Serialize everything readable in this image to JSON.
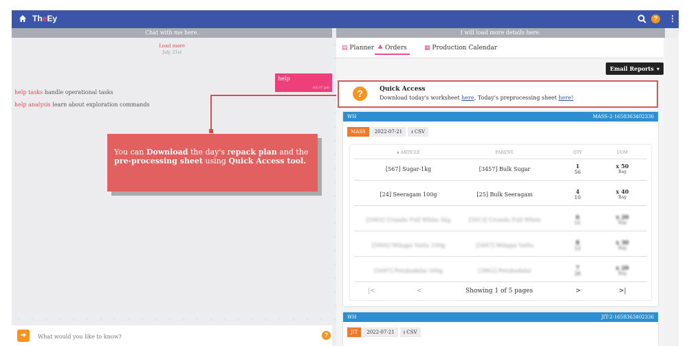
{
  "app": {
    "title_prefix": "Th",
    "title_mid": "e",
    "title_suffix": "Ey"
  },
  "header": {
    "left": "Chat with me here.",
    "right": "I will load more details here."
  },
  "chat": {
    "load_more": "Load more",
    "date": "July, 21st",
    "bubble_text": "help",
    "bubble_time": "05:37 pm",
    "help_lines": [
      {
        "cmd": "help tasks",
        "desc": "handle operational tasks"
      },
      {
        "cmd": "help analysis",
        "desc": "learn about exploration commands"
      }
    ]
  },
  "tooltip": {
    "p1": "You can ",
    "b1": "Download",
    "p2": " the day's r",
    "b2": "epack plan",
    "p3": " and the ",
    "b3": "pre-processing sheet",
    "p4": " using ",
    "b4": "Quick Access tool."
  },
  "ask": {
    "placeholder": "What would you like to know?"
  },
  "tabs": [
    {
      "label": "Planner"
    },
    {
      "label": "Orders"
    },
    {
      "label": "Production Calendar"
    }
  ],
  "email_button": "Email Reports",
  "quick_access": {
    "title": "Quick Access",
    "text_a": "Download today's worksheet ",
    "link1": "here",
    "text_b": ", Today's preprocessing sheet ",
    "link2": "here!"
  },
  "wh1": {
    "label": "WH",
    "code": "MASS-2-1658363402336",
    "chip_type": "MASS",
    "chip_date": "2022-07-21",
    "chip_csv": "CSV",
    "columns": [
      "ARTICLE",
      "PARENT.",
      "QTY",
      "UOM"
    ],
    "rows": [
      {
        "article": "[567] Sugar-1kg",
        "parent": "[3457] Bulk Sugar",
        "qty": "1",
        "qty2": "56",
        "uom": "x 50",
        "uom2": "Bag"
      },
      {
        "article": "[24] Seeragam 100g",
        "parent": "[25] Bulk Seeragam",
        "qty": "4",
        "qty2": "10",
        "uom": "x 40",
        "uom2": "Bag"
      },
      {
        "article": "[5903] Urundu Full White 5kg",
        "parent": "[5913] Urundu Full White",
        "qty": "6",
        "qty2": "11",
        "uom": "x 20",
        "uom2": "Bag"
      },
      {
        "article": "[5906] Milagai Vattu 100g",
        "parent": "[5447] Milagai Vattu",
        "qty": "8",
        "qty2": "12",
        "uom": "x 30",
        "uom2": "Bag"
      },
      {
        "article": "[5697] Potukadalai 500g",
        "parent": "[3962] Potukadalai",
        "qty": "7",
        "qty2": "26",
        "uom": "x 20",
        "uom2": "Bag"
      }
    ],
    "pagination": {
      "first": "|<",
      "prev": "<",
      "status": "Showing 1 of 5 pages",
      "next": ">",
      "last": ">|"
    }
  },
  "wh2": {
    "label": "WH",
    "code": "JIT-2-1658363402336",
    "chip_type": "JIT",
    "chip_date": "2022-07-21",
    "chip_csv": "CSV"
  },
  "colors": {
    "topbar": "#3b56a8",
    "accent": "#e94d8c",
    "tooltip": "#e36060",
    "orange": "#f5941f",
    "wh_header": "#2b8fd2"
  }
}
